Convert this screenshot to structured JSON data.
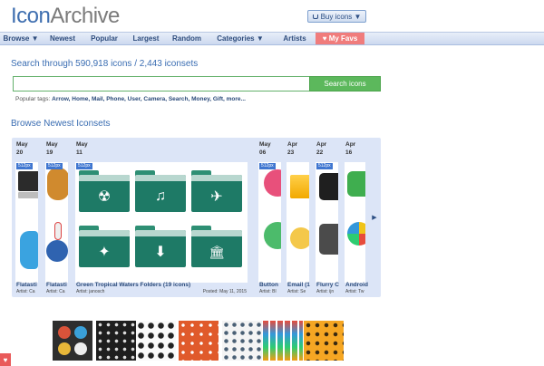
{
  "header": {
    "logo_a": "Icon",
    "logo_b": "Archive",
    "buy_label": "Buy icons ▼"
  },
  "nav": [
    {
      "label": "Browse ▼",
      "w": 46
    },
    {
      "label": "Newest"
    },
    {
      "label": "Popular"
    },
    {
      "label": "Largest"
    },
    {
      "label": "Random"
    },
    {
      "label": "Categories ▼"
    },
    {
      "label": "Artists"
    },
    {
      "label": "♥ My Favs"
    }
  ],
  "search": {
    "title": "Search through 590,918 icons / 2,443 iconsets",
    "button": "Search icons",
    "popular_label": "Popular tags:",
    "popular_tags": "Arrow, Home, Mail, Phone, User, Camera, Search, Money, Gift, more..."
  },
  "browse_title": "Browse Newest Iconsets",
  "carousel": {
    "items": [
      {
        "date_m": "May",
        "date_d": "20",
        "badge": "512px",
        "name": "Flatasti",
        "artist": "Artist: Ca"
      },
      {
        "date_m": "May",
        "date_d": "19",
        "badge": "512px",
        "name": "Flatasti",
        "artist": "Artist: Ca"
      },
      {
        "date_m": "May",
        "date_d": "11",
        "badge": "512px",
        "name": "Green Tropical Waters Folders (19 icons)",
        "artist": "Artist: janosch",
        "posted": "Posted: May 11, 2015"
      },
      {
        "date_m": "May",
        "date_d": "06",
        "badge": "512px",
        "name": "Button",
        "artist": "Artist: Bl"
      },
      {
        "date_m": "Apr",
        "date_d": "23",
        "badge": "",
        "name": "Email (1",
        "artist": "Artist: Se"
      },
      {
        "date_m": "Apr",
        "date_d": "22",
        "badge": "512px",
        "name": "Flurry C",
        "artist": "Artist: ijn"
      },
      {
        "date_m": "Apr",
        "date_d": "16",
        "badge": "",
        "name": "Android",
        "artist": "Artist: Tw"
      }
    ],
    "next_arrow": "▶"
  },
  "folder_symbols": [
    "☢",
    "♫",
    "✈",
    "✦",
    "⬇",
    "🏛"
  ],
  "heart_label": "♥"
}
